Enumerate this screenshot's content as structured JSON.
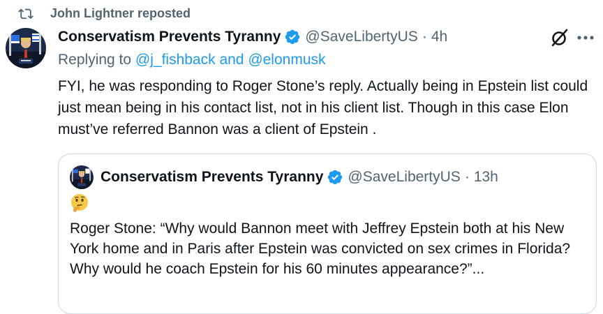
{
  "repost": {
    "label": "John Lightner reposted",
    "icon": "repost-icon"
  },
  "tweet": {
    "author_name": "Conservatism Prevents Tyranny",
    "handle": "@SaveLibertyUS",
    "separator": "·",
    "time": "4h",
    "reply_prefix": "Replying to ",
    "reply_mentions": "@j_fishback and @elonmusk",
    "text": "FYI, he was responding to Roger Stone’s reply. Actually being in Epstein list could just mean being in his contact list, not in his client list.  Though in this case Elon must’ve referred Bannon was a client of Epstein .",
    "icons": [
      "verified-badge-icon",
      "grok-icon",
      "more-icon"
    ]
  },
  "quote": {
    "author_name": "Conservatism Prevents Tyranny",
    "handle": "@SaveLibertyUS",
    "separator": "·",
    "time": "13h",
    "emoji": "thinking-face",
    "text": "Roger Stone: “Why would Bannon meet with Jeffrey Epstein both at his New York home and in Paris after Epstein was convicted on sex crimes in Florida? Why would he coach Epstein for his 60 minutes appearance?”..."
  },
  "colors": {
    "text_primary": "#0f1419",
    "text_secondary": "#536471",
    "accent": "#1d9bf0",
    "border": "#cfd9de"
  }
}
